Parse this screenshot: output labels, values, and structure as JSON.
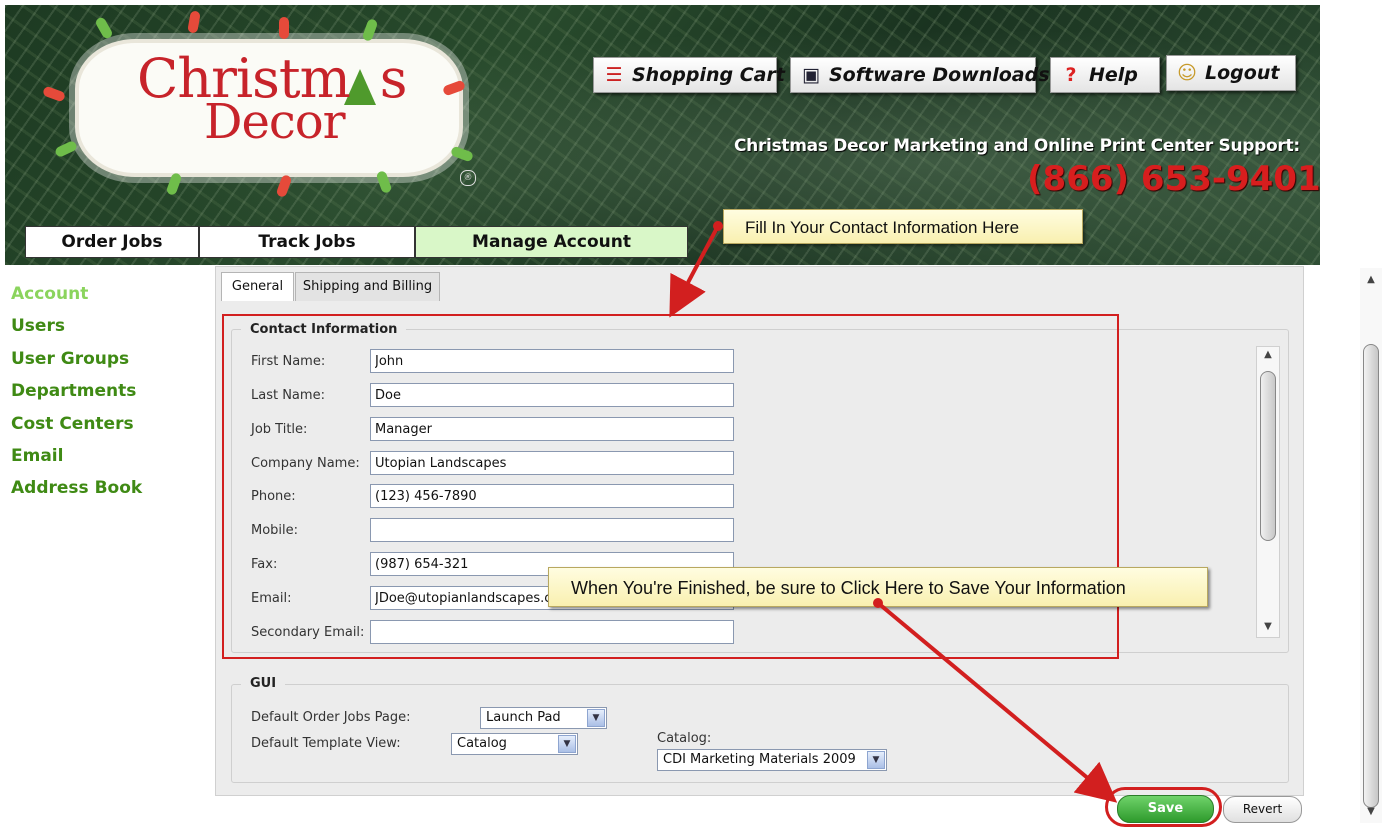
{
  "header": {
    "logo": {
      "line1": "Christm",
      "line1_tail": "s",
      "line2": "Decor",
      "registered": "®"
    },
    "buttons": [
      {
        "label": "Shopping Cart",
        "icon": "cart-icon"
      },
      {
        "label": "Software Downloads",
        "icon": "floppy-disk-icon"
      },
      {
        "label": "Help",
        "icon": "question-mark-icon"
      },
      {
        "label": "Logout",
        "icon": "user-logout-icon"
      }
    ],
    "support_text": "Christmas Decor Marketing and Online Print Center Support:",
    "support_phone": "(866) 653-9401"
  },
  "nav": {
    "tabs": [
      {
        "label": "Order Jobs",
        "active": false
      },
      {
        "label": "Track Jobs",
        "active": false
      },
      {
        "label": "Manage Account",
        "active": true
      }
    ]
  },
  "callouts": {
    "fill_in": "Fill In Your Contact Information Here",
    "save": "When You're Finished, be sure to Click Here to Save Your Information"
  },
  "sidebar": {
    "items": [
      {
        "label": "Account",
        "active": true
      },
      {
        "label": "Users"
      },
      {
        "label": "User Groups"
      },
      {
        "label": "Departments"
      },
      {
        "label": "Cost Centers"
      },
      {
        "label": "Email"
      },
      {
        "label": "Address Book"
      }
    ]
  },
  "tabs": [
    {
      "label": "General",
      "active": true
    },
    {
      "label": "Shipping and Billing"
    }
  ],
  "contact": {
    "legend": "Contact Information",
    "fields": [
      {
        "label": "First Name:",
        "value": "John"
      },
      {
        "label": "Last Name:",
        "value": "Doe"
      },
      {
        "label": "Job Title:",
        "value": "Manager"
      },
      {
        "label": "Company Name:",
        "value": "Utopian Landscapes"
      },
      {
        "label": "Phone:",
        "value": "(123) 456-7890"
      },
      {
        "label": "Mobile:",
        "value": ""
      },
      {
        "label": "Fax:",
        "value": "(987) 654-321"
      },
      {
        "label": "Email:",
        "value": "JDoe@utopianlandscapes.c"
      },
      {
        "label": "Secondary Email:",
        "value": ""
      }
    ]
  },
  "gui": {
    "legend": "GUI",
    "default_order_jobs_label": "Default Order Jobs Page:",
    "default_order_jobs_value": "Launch Pad",
    "default_template_label": "Default Template View:",
    "default_template_value": "Catalog",
    "catalog_label": "Catalog:",
    "catalog_value": "CDI Marketing Materials 2009"
  },
  "actions": {
    "save": "Save",
    "revert": "Revert"
  },
  "colors": {
    "sidebar_link": "#3f8a14",
    "sidebar_active": "#8bd45d",
    "annotation_red": "#d21f1f",
    "nav_active_bg": "#d9f7c8",
    "phone_red": "#d71e1e"
  }
}
